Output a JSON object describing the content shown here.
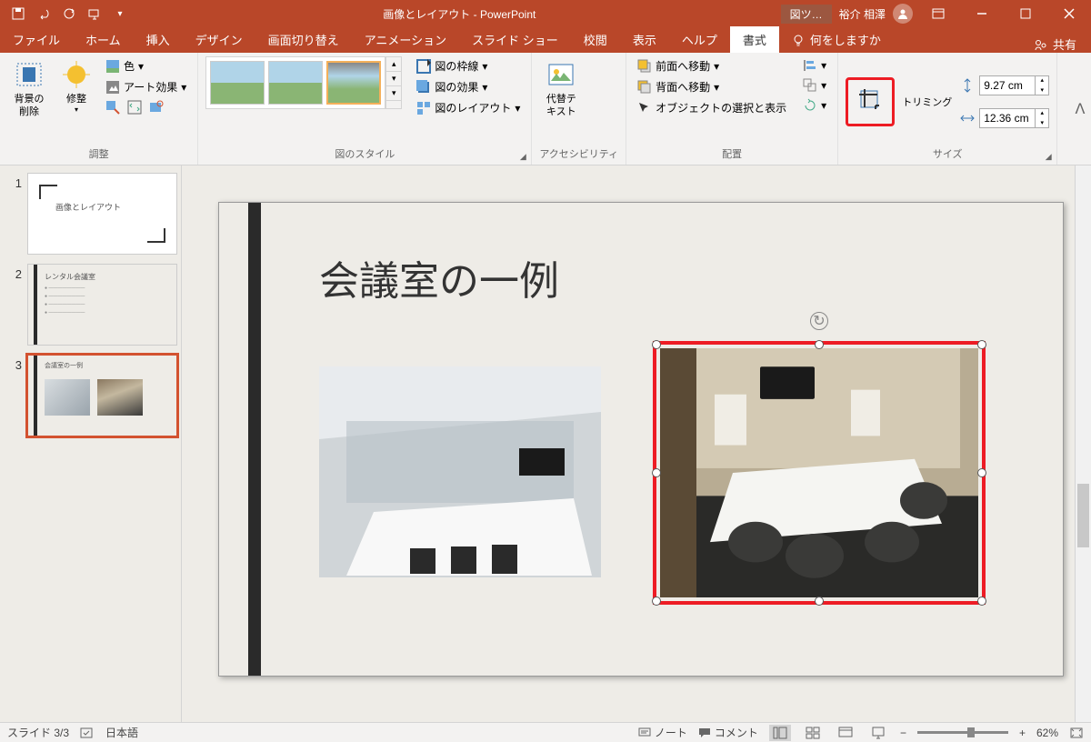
{
  "title": {
    "doc": "画像とレイアウト",
    "app": "PowerPoint",
    "context_tab": "図ツ…",
    "user": "裕介 相澤"
  },
  "tabs": {
    "file": "ファイル",
    "home": "ホーム",
    "insert": "挿入",
    "design": "デザイン",
    "transitions": "画面切り替え",
    "animations": "アニメーション",
    "slideshow": "スライド ショー",
    "review": "校閲",
    "view": "表示",
    "help": "ヘルプ",
    "format": "書式",
    "tell_me": "何をしますか",
    "share": "共有"
  },
  "ribbon": {
    "remove_bg": "背景の\n削除",
    "corrections": "修整",
    "color": "色",
    "artistic": "アート効果",
    "adjust_label": "調整",
    "styles_label": "図のスタイル",
    "border": "図の枠線",
    "effects": "図の効果",
    "layout": "図のレイアウト",
    "alt_text": "代替テ\nキスト",
    "accessibility_label": "アクセシビリティ",
    "bring_forward": "前面へ移動",
    "send_backward": "背面へ移動",
    "selection_pane": "オブジェクトの選択と表示",
    "arrange_label": "配置",
    "crop": "トリミング",
    "size_label": "サイズ",
    "height": "9.27 cm",
    "width": "12.36 cm"
  },
  "slide": {
    "title": "会議室の一例"
  },
  "thumbs": {
    "t1": "画像とレイアウト",
    "t2": "レンタル会議室",
    "t3": "会議室の一例"
  },
  "status": {
    "slide": "スライド 3/3",
    "lang": "日本語",
    "notes": "ノート",
    "comments": "コメント",
    "zoom": "62%"
  }
}
